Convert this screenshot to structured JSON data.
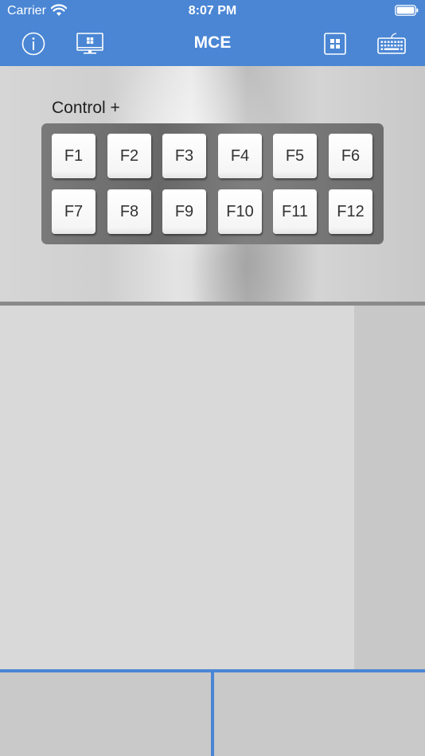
{
  "status_bar": {
    "carrier": "Carrier",
    "time": "8:07 PM",
    "wifi_icon": "wifi-icon",
    "battery_icon": "battery-icon"
  },
  "nav": {
    "title": "MCE",
    "left_buttons": [
      {
        "icon": "info-icon"
      },
      {
        "icon": "monitor-icon"
      }
    ],
    "right_buttons": [
      {
        "icon": "grid-icon"
      },
      {
        "icon": "keyboard-icon"
      }
    ]
  },
  "control_panel": {
    "label": "Control +",
    "keys": [
      "F1",
      "F2",
      "F3",
      "F4",
      "F5",
      "F6",
      "F7",
      "F8",
      "F9",
      "F10",
      "F11",
      "F12"
    ]
  },
  "colors": {
    "accent": "#4a86d4",
    "trackpad": "#d9d9d9",
    "scroll_strip": "#c8c8c8",
    "key_panel": "#6e6e6e"
  }
}
